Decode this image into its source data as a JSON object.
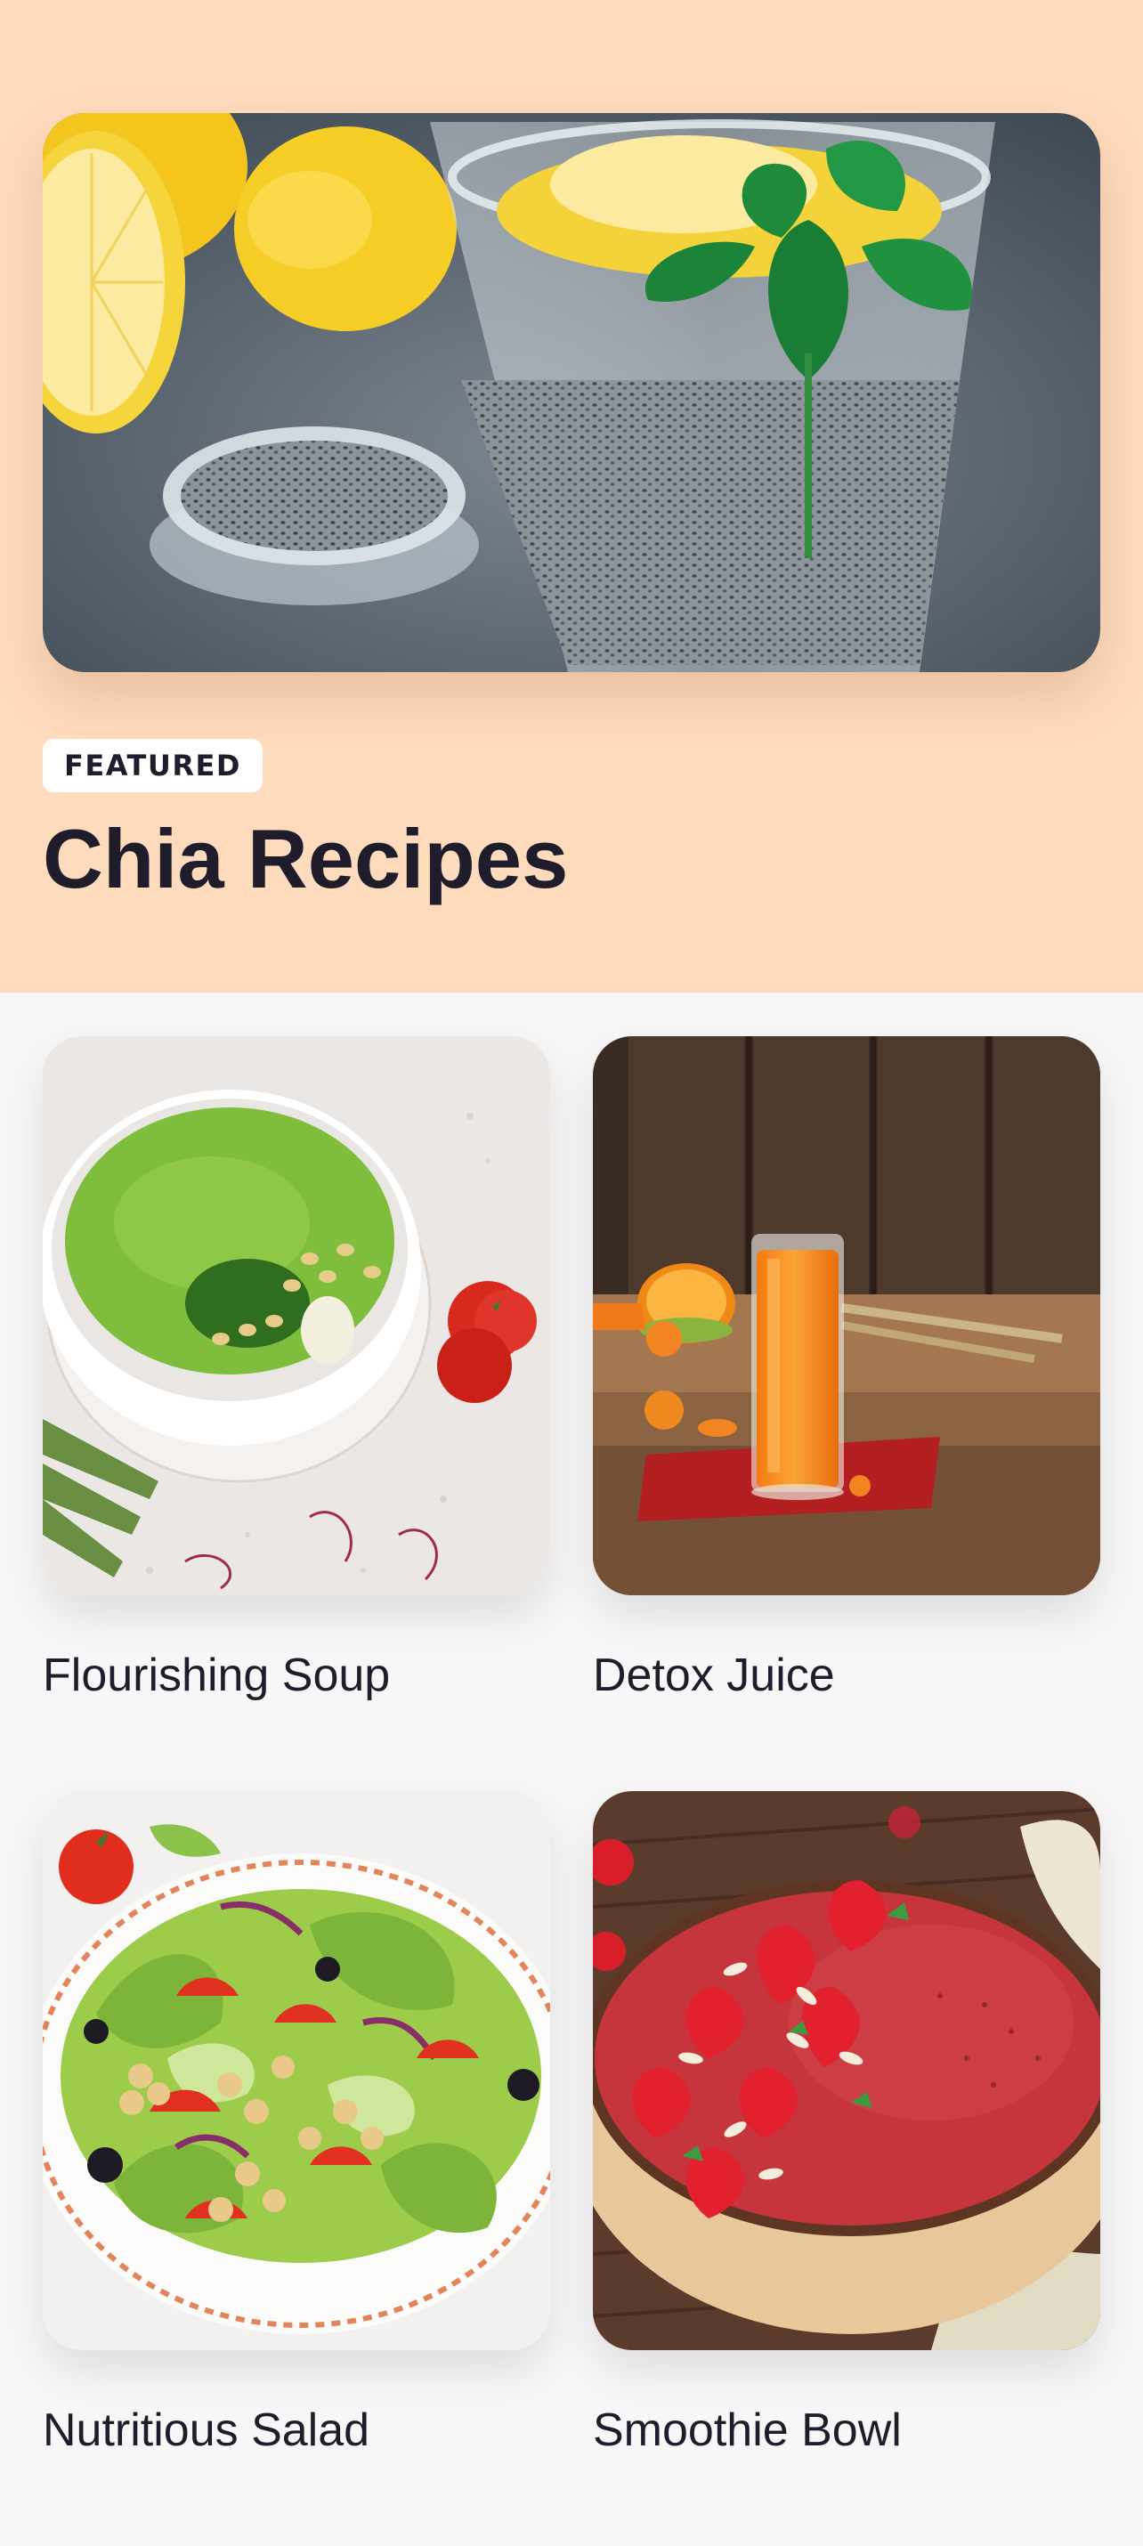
{
  "featured": {
    "badge": "FEATURED",
    "title": "Chia Recipes",
    "background_color": "#ffdbbe",
    "image_icon": "chia-water-glass-image"
  },
  "recipes": [
    {
      "title": "Flourishing Soup",
      "image_icon": "green-soup-image"
    },
    {
      "title": "Detox Juice",
      "image_icon": "orange-juice-image"
    },
    {
      "title": "Nutritious Salad",
      "image_icon": "salad-image"
    },
    {
      "title": "Smoothie Bowl",
      "image_icon": "smoothie-bowl-image"
    }
  ]
}
